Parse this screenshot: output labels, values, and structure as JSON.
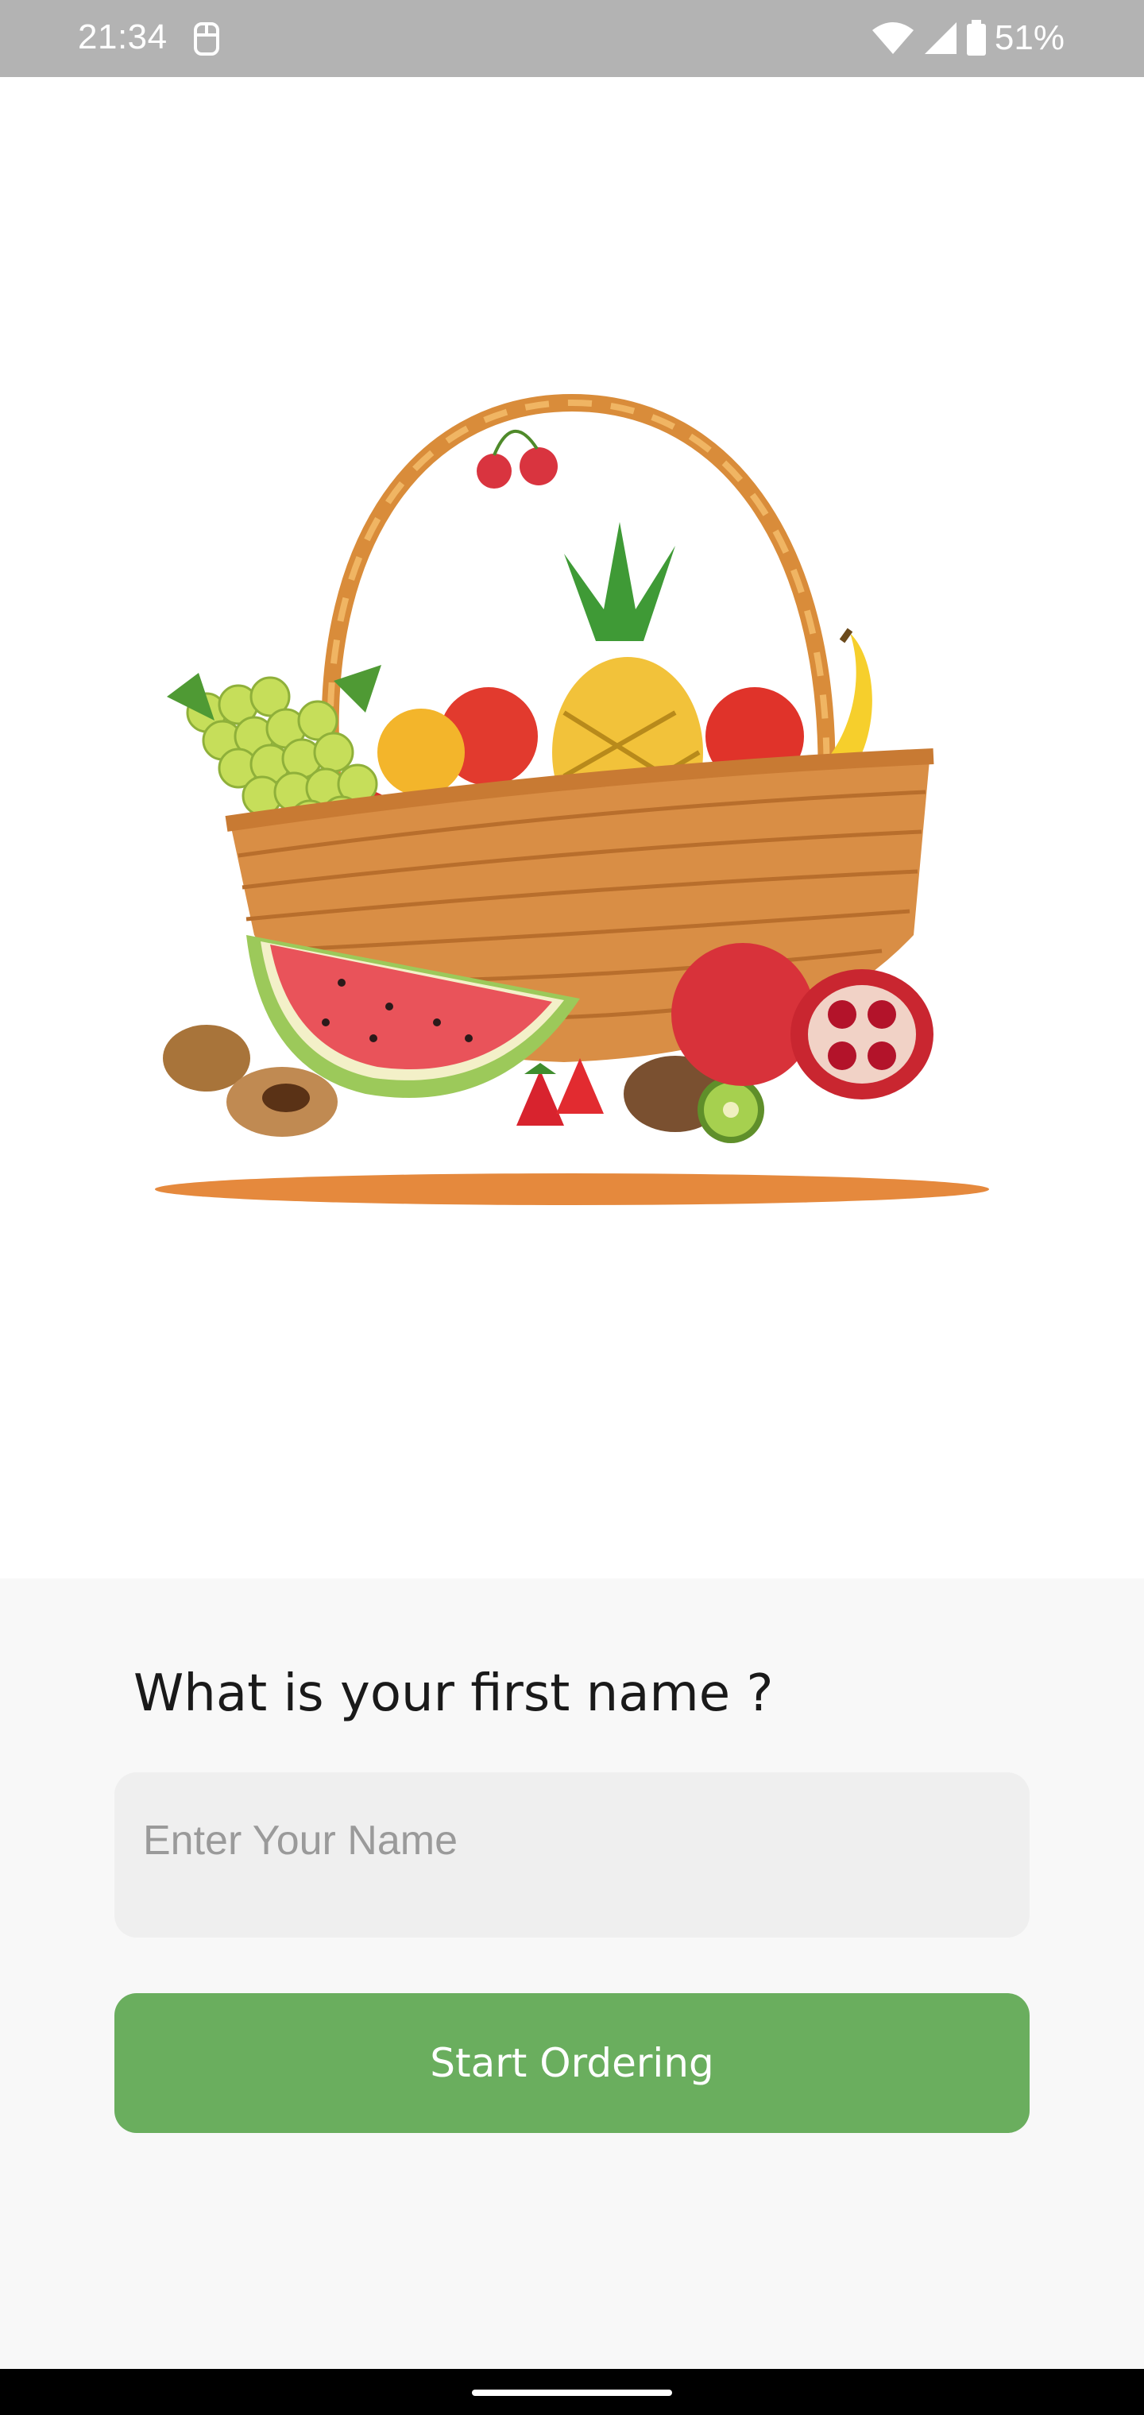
{
  "status_bar": {
    "time": "21:34",
    "battery": "51%",
    "icons": [
      "app-notification-icon",
      "wifi-icon",
      "cellular-signal-icon",
      "battery-icon"
    ]
  },
  "hero": {
    "image": "fruit-basket-illustration"
  },
  "form": {
    "question": "What is your first name ?",
    "name_placeholder": "Enter Your Name",
    "name_value": "",
    "start_label": "Start Ordering"
  },
  "colors": {
    "status_bar": "#b3b3b3",
    "sheet_background": "#f8f8f8",
    "input_background": "#efefef",
    "accent_green": "#6aae5e",
    "nav_bar": "#000000"
  }
}
